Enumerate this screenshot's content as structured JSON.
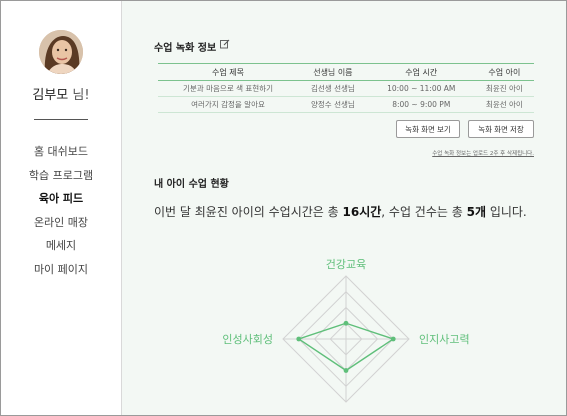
{
  "user": {
    "name": "김부모",
    "suffix": " 님!"
  },
  "nav": {
    "items": [
      {
        "label": "홈 대쉬보드"
      },
      {
        "label": "학습 프로그램"
      },
      {
        "label": "육아 피드"
      },
      {
        "label": "온라인 매장"
      },
      {
        "label": "메세지"
      },
      {
        "label": "마이 페이지"
      }
    ]
  },
  "recordings": {
    "title": "수업 녹화 정보",
    "headers": [
      "수업 제목",
      "선생님 이름",
      "수업 시간",
      "수업 아이"
    ],
    "rows": [
      [
        "기분과 마음으로 색 표현하기",
        "김선생 선생님",
        "10:00 ~ 11:00 AM",
        "최윤진 아이"
      ],
      [
        "여러가지 감정을 알아요",
        "양정수 선생님",
        "8:00 ~ 9:00 PM",
        "최윤선 아이"
      ]
    ],
    "view_button": "녹화 화면 보기",
    "save_button": "녹화 화면 저장",
    "notice": "수업 녹화 정보는 업로드 2주 후 삭제됩니다."
  },
  "status": {
    "title": "내 아이 수업 현황",
    "summary_prefix": "이번 달 최윤진 아이의 수업시간은 총 ",
    "hours": "16시간",
    "summary_middle": ", 수업 건수는 총 ",
    "count": "5개",
    "summary_suffix": " 입니다."
  },
  "chart_data": {
    "type": "radar",
    "axes": [
      "건강교육",
      "인지사고력",
      "",
      "인성사회성"
    ],
    "levels": 4,
    "max": 4,
    "series": [
      {
        "values": [
          1,
          3,
          2,
          3
        ]
      }
    ],
    "color": "#5fbf7a"
  },
  "colors": {
    "accent": "#5fbf7a",
    "background": "#f3f8f4"
  }
}
